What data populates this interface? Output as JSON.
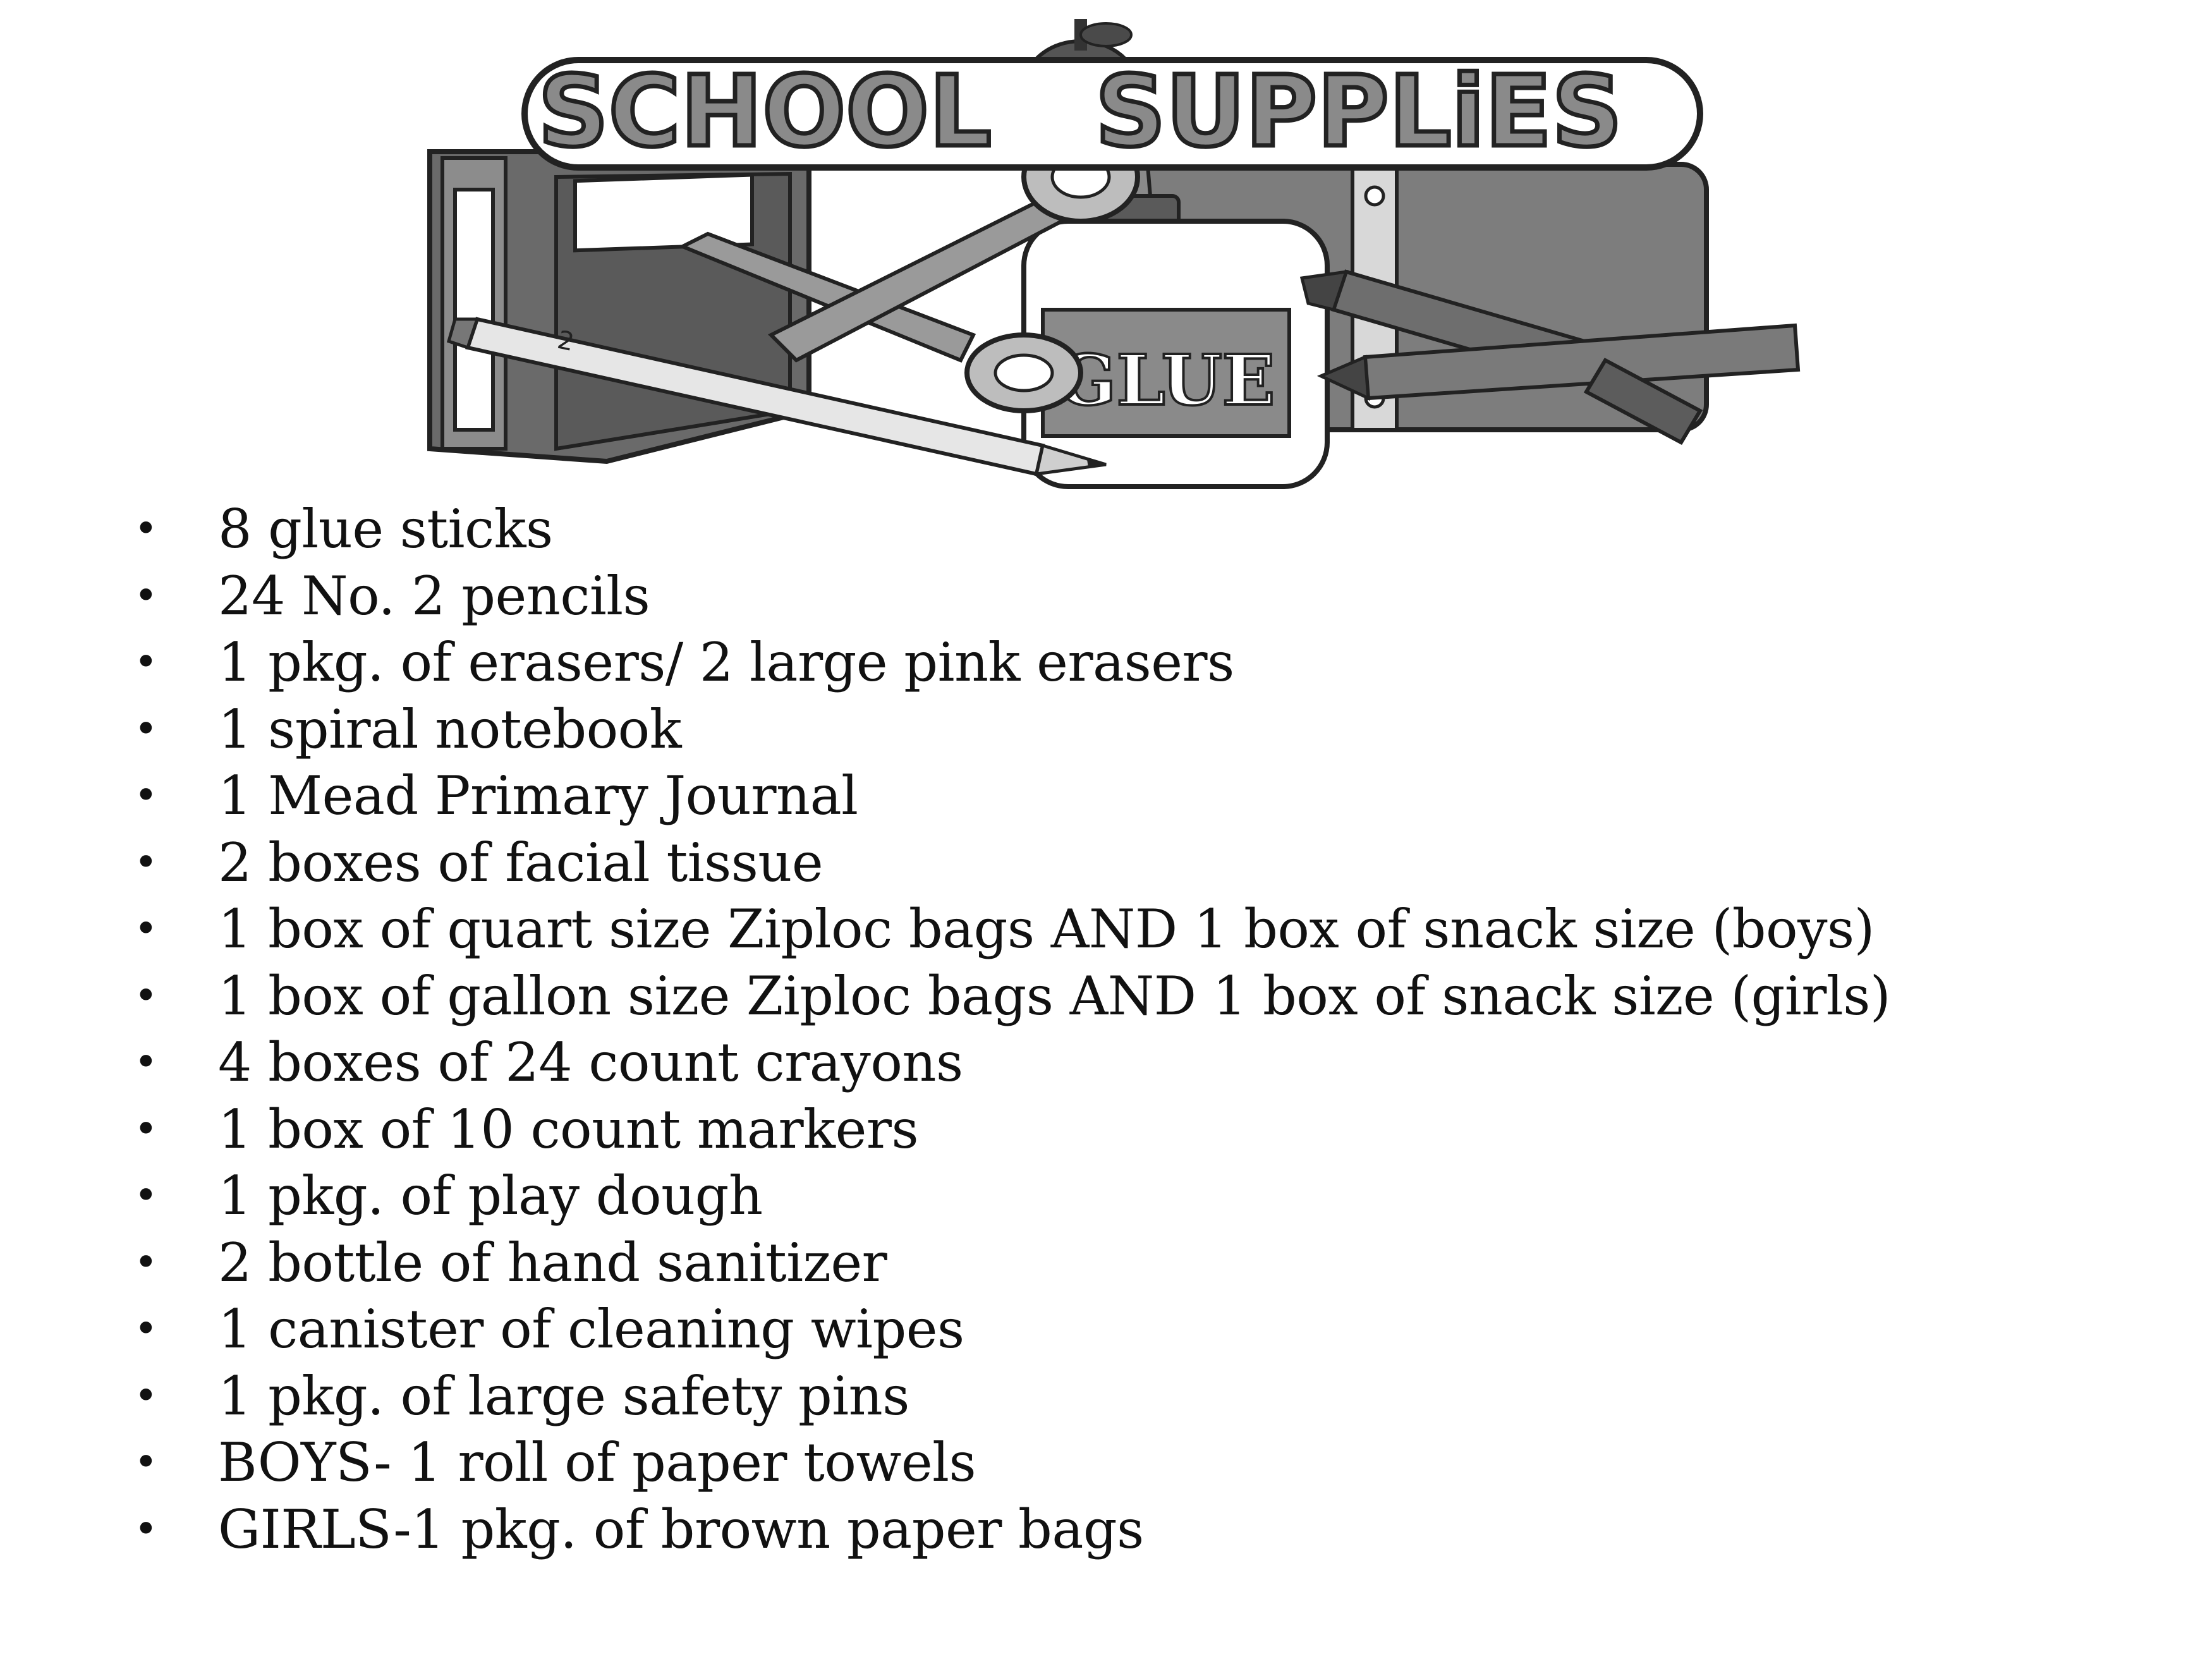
{
  "header": {
    "title_left": "SCHOOL",
    "title_right": "SUPPLiES",
    "glue_label": "GLUE",
    "pencil_number": "2"
  },
  "colors": {
    "outline": "#2a2a2a",
    "dark_gray": "#5e5e5e",
    "mid_gray": "#8c8c8c",
    "light_gray": "#c8c8c8",
    "white": "#ffffff"
  },
  "list": {
    "bullet": "•",
    "items": [
      "8 glue sticks",
      "24 No. 2 pencils",
      "1 pkg. of erasers/ 2 large pink erasers",
      "1 spiral notebook",
      "1 Mead Primary Journal",
      "2 boxes of facial tissue",
      "1 box of quart size Ziploc bags AND 1 box of snack size (boys)",
      "1 box of gallon size Ziploc bags AND 1 box of snack size (girls)",
      "4 boxes of 24 count crayons",
      "1 box of 10 count markers",
      "1 pkg. of play dough",
      "2 bottle of hand sanitizer",
      "1 canister of cleaning wipes",
      "1 pkg. of large safety pins",
      "BOYS- 1 roll of paper towels",
      "GIRLS-1 pkg. of brown paper bags"
    ]
  }
}
